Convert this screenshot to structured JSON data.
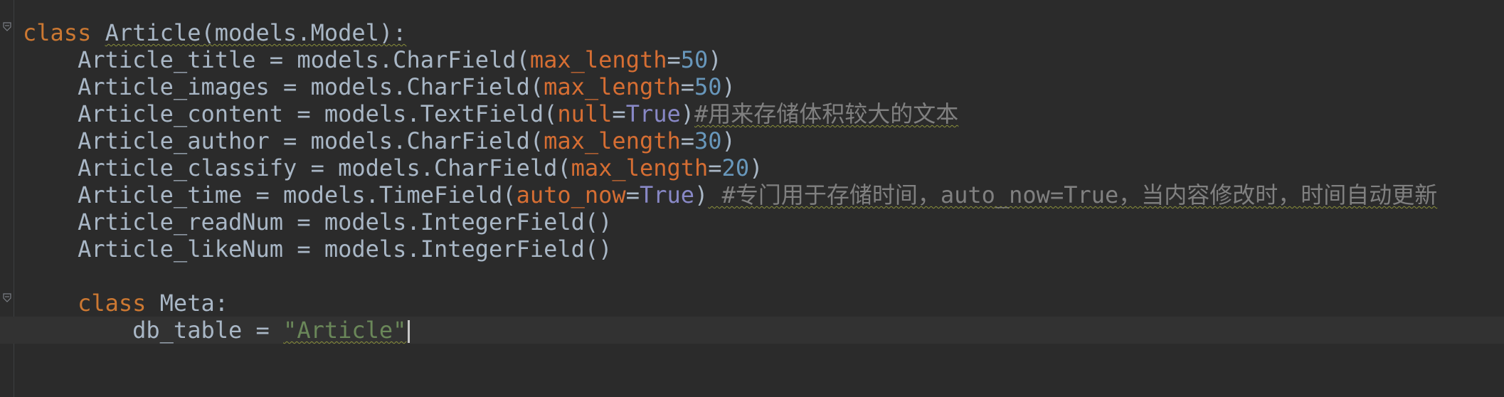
{
  "editor": {
    "lines": [
      {
        "indent": "",
        "parts": [
          {
            "t": "class",
            "c": "kw"
          },
          {
            "t": " "
          },
          {
            "t": "Article",
            "c": "squig"
          },
          {
            "t": "(models.Model):",
            "c": "squig"
          }
        ]
      },
      {
        "indent": "    ",
        "parts": [
          {
            "t": "Article_title = models.CharField("
          },
          {
            "t": "max_length",
            "c": "prm"
          },
          {
            "t": "="
          },
          {
            "t": "50",
            "c": "num"
          },
          {
            "t": ")"
          }
        ]
      },
      {
        "indent": "    ",
        "parts": [
          {
            "t": "Article_images = models.CharField("
          },
          {
            "t": "max_length",
            "c": "prm"
          },
          {
            "t": "="
          },
          {
            "t": "50",
            "c": "num"
          },
          {
            "t": ")"
          }
        ]
      },
      {
        "indent": "    ",
        "parts": [
          {
            "t": "Article_content = models.TextField("
          },
          {
            "t": "null",
            "c": "prm"
          },
          {
            "t": "="
          },
          {
            "t": "True",
            "c": "cst"
          },
          {
            "t": ")"
          },
          {
            "t": "#用来存储体积较大的文本",
            "c": "cmt squig"
          }
        ]
      },
      {
        "indent": "    ",
        "parts": [
          {
            "t": "Article_author = models.CharField("
          },
          {
            "t": "max_length",
            "c": "prm"
          },
          {
            "t": "="
          },
          {
            "t": "30",
            "c": "num"
          },
          {
            "t": ")"
          }
        ]
      },
      {
        "indent": "    ",
        "parts": [
          {
            "t": "Article_classify = models.CharField("
          },
          {
            "t": "max_length",
            "c": "prm"
          },
          {
            "t": "="
          },
          {
            "t": "20",
            "c": "num"
          },
          {
            "t": ")"
          }
        ]
      },
      {
        "indent": "    ",
        "parts": [
          {
            "t": "Article_time = models.TimeField("
          },
          {
            "t": "auto_now",
            "c": "prm"
          },
          {
            "t": "="
          },
          {
            "t": "True",
            "c": "cst"
          },
          {
            "t": ")"
          },
          {
            "t": " #专门用于存储时间，auto_now=True，当内容修改时，时间自动更新",
            "c": "cmt squig"
          }
        ]
      },
      {
        "indent": "    ",
        "parts": [
          {
            "t": "Article_readNum = models.IntegerField()"
          }
        ]
      },
      {
        "indent": "    ",
        "parts": [
          {
            "t": "Article_likeNum = models.IntegerField()"
          }
        ]
      },
      {
        "indent": "",
        "parts": []
      },
      {
        "indent": "    ",
        "parts": [
          {
            "t": "class",
            "c": "kw"
          },
          {
            "t": " Meta:"
          }
        ]
      },
      {
        "indent": "        ",
        "current": true,
        "cursor": true,
        "parts": [
          {
            "t": "db_table = "
          },
          {
            "t": "\"Article\"",
            "c": "str squig"
          }
        ]
      }
    ]
  },
  "icons": {
    "fold_open": "fold-open-icon",
    "fold_close": "fold-close-icon",
    "intention_bulb": "lightbulb-icon"
  },
  "colors": {
    "background": "#2b2b2b",
    "current_line": "#323232",
    "keyword": "#cc7832",
    "parameter": "#d66e33",
    "number": "#6897bb",
    "builtin_constant": "#8888c6",
    "string": "#6a8759",
    "comment": "#808080",
    "default_text": "#a9b7c6"
  }
}
